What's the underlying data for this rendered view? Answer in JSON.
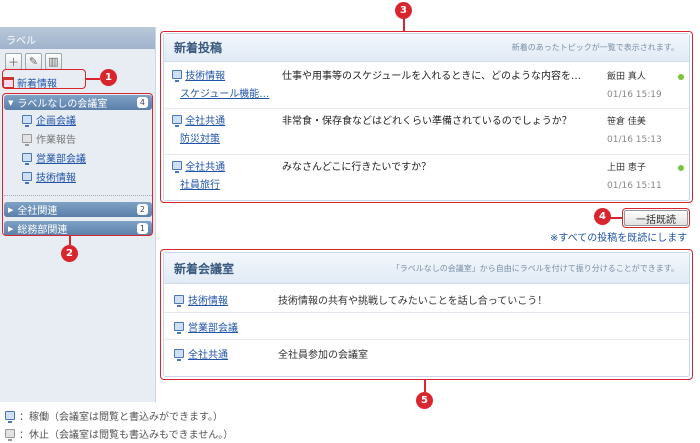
{
  "sidebar": {
    "title": "ラベル",
    "tools": [
      "plus-icon",
      "pencil-icon",
      "trash-icon"
    ],
    "new_info": "新着情報",
    "groups": [
      {
        "label": "ラベルなしの会議室",
        "count": "4",
        "items": [
          {
            "label": "企画会議",
            "status": "active"
          },
          {
            "label": "作業報告",
            "status": "inactive"
          },
          {
            "label": "営業部会議",
            "status": "active"
          },
          {
            "label": "技術情報",
            "status": "active"
          }
        ]
      },
      {
        "label": "全社関連",
        "count": "2"
      },
      {
        "label": "総務部関連",
        "count": "1"
      }
    ]
  },
  "new_posts": {
    "title": "新着投稿",
    "desc": "新着のあったトピックが一覧で表示されます。",
    "rows": [
      {
        "room": "技術情報",
        "topic": "スケジュール機能…",
        "text": "仕事や用事等のスケジュールを入れるときに、どのような内容を…",
        "author": "飯田 真人",
        "time": "01/16 15:19",
        "unread": true
      },
      {
        "room": "全社共通",
        "topic": "防災対策",
        "text": "非常食・保存食などはどれくらい準備されているのでしょうか？",
        "author": "笹倉 佳美",
        "time": "01/16 15:13",
        "unread": false
      },
      {
        "room": "全社共通",
        "topic": "社員旅行",
        "text": "みなさんどこに行きたいですか？",
        "author": "上田 恵子",
        "time": "01/16 15:11",
        "unread": true
      }
    ]
  },
  "mark_read": {
    "button": "一括既読",
    "link": "※すべての投稿を既読にします"
  },
  "new_rooms": {
    "title": "新着会議室",
    "desc": "「ラベルなしの会議室」から自由にラベルを付けて振り分けることができます。",
    "rows": [
      {
        "room": "技術情報",
        "text": "技術情報の共有や挑戦してみたいことを話し合っていこう！"
      },
      {
        "room": "営業部会議",
        "text": ""
      },
      {
        "room": "全社共通",
        "text": "全社員参加の会議室"
      }
    ]
  },
  "legend": [
    {
      "icon": "active-room-icon",
      "text": "：稼働（会議室は閲覧と書込みができます。）"
    },
    {
      "icon": "inactive-room-icon",
      "text": "：休止（会議室は閲覧も書込みもできません。）"
    }
  ],
  "callouts": [
    "1",
    "2",
    "3",
    "4",
    "5"
  ],
  "colors": {
    "callout": "#d9262e",
    "link": "#2255aa",
    "unread": "#7cc23a"
  }
}
